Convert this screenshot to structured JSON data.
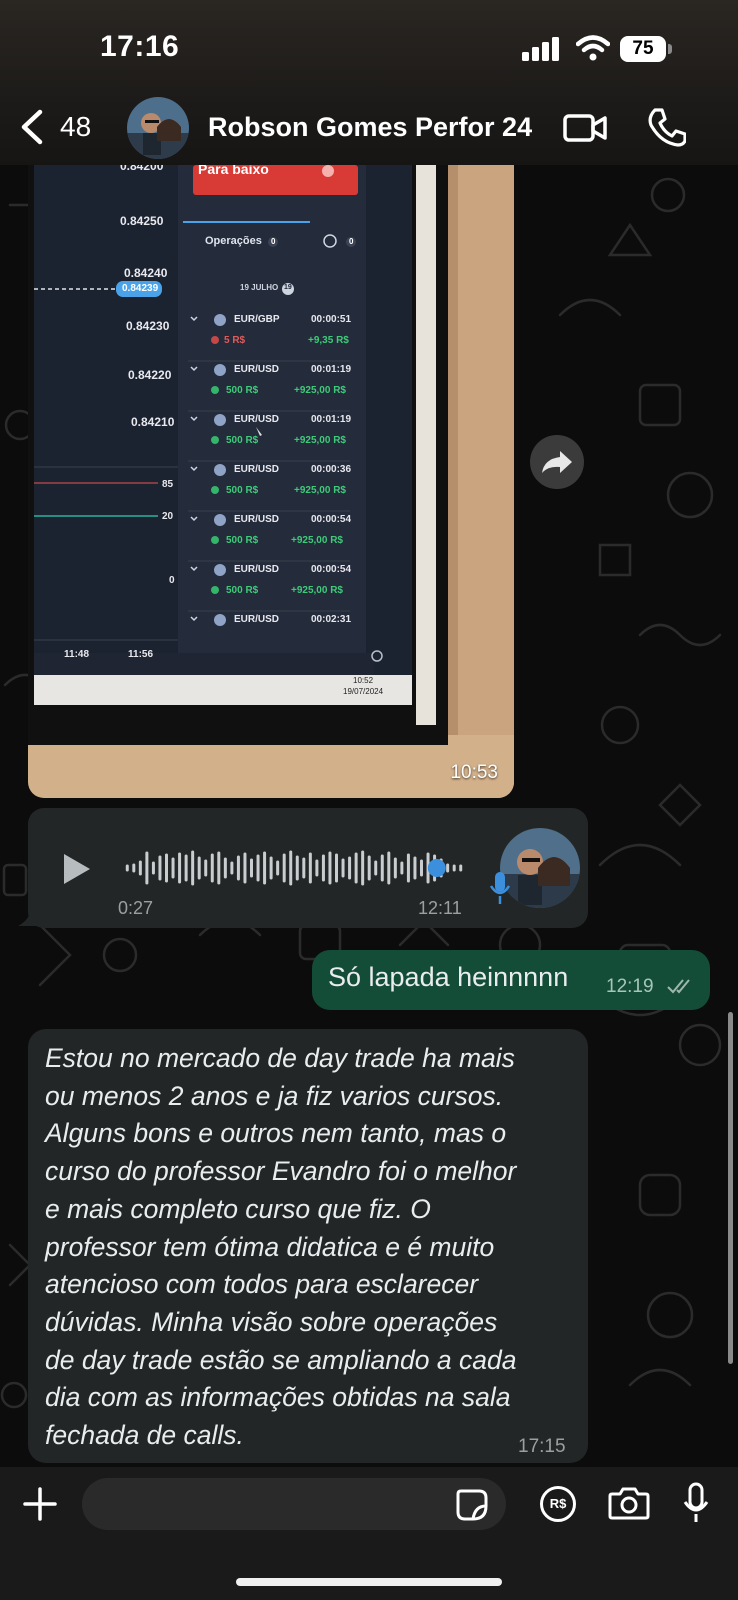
{
  "status_bar": {
    "time": "17:16",
    "battery": "75"
  },
  "header": {
    "back_count": "48",
    "contact_name": "Robson Gomes Perfor 24"
  },
  "image_message": {
    "time": "10:53",
    "screen": {
      "button_label": "Para baixo",
      "panel_title": "Operações",
      "panel_count": "0",
      "history_count": "0",
      "date_label": "19 JULHO",
      "date_badge": "19",
      "prices": [
        "0.84200",
        "0.84250",
        "0.84240",
        "0.84239",
        "0.84230",
        "0.84220",
        "0.84210"
      ],
      "indicator_levels": [
        "85",
        "20",
        "0"
      ],
      "x_times": [
        "11:48",
        "11:56"
      ],
      "clock_time": "10:52",
      "clock_date": "19/07/2024",
      "operations": [
        {
          "pair": "EUR/GBP",
          "duration": "00:00:51",
          "amount": "5 R$",
          "profit": "+9,35 R$"
        },
        {
          "pair": "EUR/USD",
          "duration": "00:01:19",
          "amount": "500 R$",
          "profit": "+925,00 R$"
        },
        {
          "pair": "EUR/USD",
          "duration": "00:01:19",
          "amount": "500 R$",
          "profit": "+925,00 R$"
        },
        {
          "pair": "EUR/USD",
          "duration": "00:00:36",
          "amount": "500 R$",
          "profit": "+925,00 R$"
        },
        {
          "pair": "EUR/USD",
          "duration": "00:00:54",
          "amount": "500 R$",
          "profit": "+925,00 R$"
        },
        {
          "pair": "EUR/USD",
          "duration": "00:00:54",
          "amount": "500 R$",
          "profit": "+925,00 R$"
        },
        {
          "pair": "EUR/USD",
          "duration": "00:02:31",
          "amount": "",
          "profit": ""
        }
      ]
    }
  },
  "voice_message": {
    "duration": "0:27",
    "time": "12:11",
    "progress": 0.92
  },
  "outgoing_message": {
    "text": "Só lapada heinnnnn",
    "time": "12:19"
  },
  "incoming_message": {
    "lines": [
      "Estou no mercado de day trade ha mais",
      "ou menos 2 anos e ja fiz varios cursos.",
      "Alguns bons e outros nem tanto, mas o",
      "curso do professor Evandro foi o melhor",
      "e mais completo curso que fiz. O",
      "professor tem ótima didatica e é muito",
      "atencioso com todos para esclarecer",
      "dúvidas. Minha visão sobre operações",
      "de day trade estão se ampliando a cada",
      "dia com as informações obtidas na sala",
      "fechada de calls."
    ],
    "time": "17:15"
  },
  "input_bar": {
    "placeholder": "",
    "pay_label": "R$"
  }
}
